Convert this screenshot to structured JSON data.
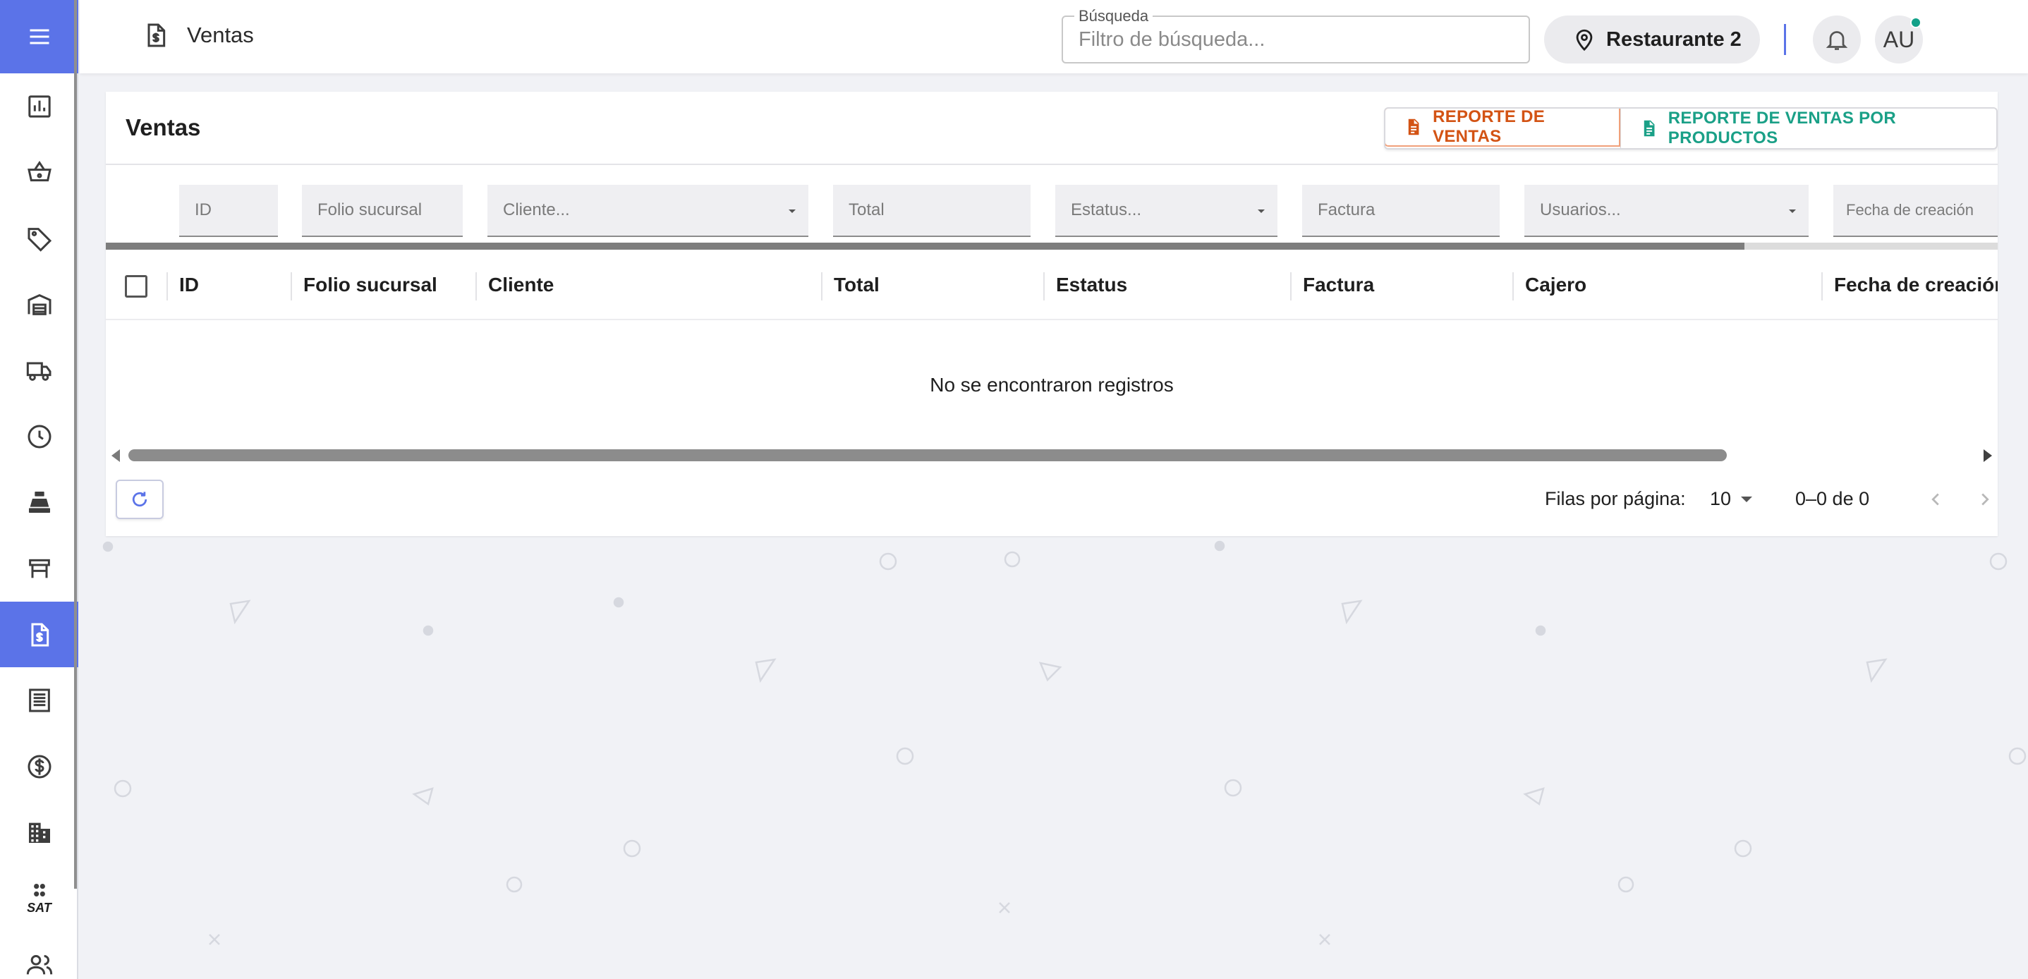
{
  "header": {
    "page_title": "Ventas",
    "search": {
      "legend": "Búsqueda",
      "placeholder": "Filtro de búsqueda..."
    },
    "location": "Restaurante 2",
    "avatar_initials": "AU"
  },
  "sidebar": {
    "active_index": 8,
    "items": [
      {
        "icon": "bar-chart-icon"
      },
      {
        "icon": "shopping-basket-icon"
      },
      {
        "icon": "tag-icon"
      },
      {
        "icon": "warehouse-icon"
      },
      {
        "icon": "truck-icon"
      },
      {
        "icon": "clock-icon"
      },
      {
        "icon": "cash-register-icon"
      },
      {
        "icon": "table-icon"
      },
      {
        "icon": "sales-document-icon"
      },
      {
        "icon": "receipt-icon"
      },
      {
        "icon": "dollar-circle-icon"
      },
      {
        "icon": "building-icon"
      },
      {
        "icon": "sat-icon",
        "label": "SAT"
      },
      {
        "icon": "users-icon"
      }
    ]
  },
  "card": {
    "title": "Ventas",
    "report_sales_label": "REPORTE DE VENTAS",
    "report_sales_products_label": "REPORTE DE VENTAS POR PRODUCTOS"
  },
  "filters": {
    "id": "ID",
    "folio": "Folio sucursal",
    "cliente": "Cliente...",
    "total": "Total",
    "estatus": "Estatus...",
    "factura": "Factura",
    "usuarios": "Usuarios...",
    "fecha": "Fecha de creación"
  },
  "table": {
    "columns": [
      "ID",
      "Folio sucursal",
      "Cliente",
      "Total",
      "Estatus",
      "Factura",
      "Cajero",
      "Fecha de creación"
    ],
    "rows": [],
    "empty_message": "No se encontraron registros"
  },
  "pagination": {
    "rows_per_page_label": "Filas por página:",
    "rows_per_page": "10",
    "range": "0–0 de 0"
  },
  "colors": {
    "accent": "#5b73e8",
    "report_orange": "#d35314",
    "report_green": "#1aa087",
    "notification_dot": "#12a189"
  }
}
